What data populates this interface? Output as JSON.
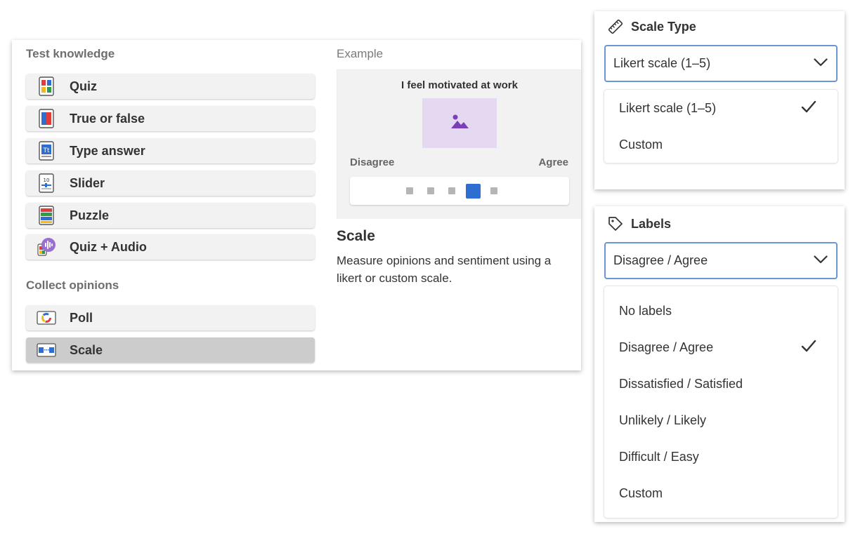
{
  "question_types": {
    "test_knowledge_title": "Test knowledge",
    "test_knowledge_items": [
      {
        "label": "Quiz",
        "icon": "quiz-icon"
      },
      {
        "label": "True or false",
        "icon": "true-false-icon"
      },
      {
        "label": "Type answer",
        "icon": "type-answer-icon"
      },
      {
        "label": "Slider",
        "icon": "slider-icon"
      },
      {
        "label": "Puzzle",
        "icon": "puzzle-icon"
      },
      {
        "label": "Quiz + Audio",
        "icon": "quiz-audio-icon"
      }
    ],
    "collect_opinions_title": "Collect opinions",
    "collect_opinions_items": [
      {
        "label": "Poll",
        "icon": "poll-icon"
      },
      {
        "label": "Scale",
        "icon": "scale-icon",
        "selected": true
      }
    ]
  },
  "example": {
    "label": "Example",
    "question": "I feel motivated at work",
    "left_label": "Disagree",
    "right_label": "Agree",
    "scale_points": 5,
    "selected_point": 4,
    "title": "Scale",
    "description": "Measure opinions and sentiment using a likert or custom scale."
  },
  "scale_type": {
    "title": "Scale Type",
    "icon": "ruler-icon",
    "selected": "Likert scale (1–5)",
    "options": [
      "Likert scale (1–5)",
      "Custom"
    ],
    "checked_index": 0
  },
  "labels": {
    "title": "Labels",
    "icon": "tag-icon",
    "selected": "Disagree / Agree",
    "options": [
      "No labels",
      "Disagree / Agree",
      "Dissatisfied / Satisfied",
      "Unlikely / Likely",
      "Difficult / Easy",
      "Custom"
    ],
    "checked_index": 1
  },
  "colors": {
    "accent": "#2d6ed0",
    "select_border": "#6b95d6",
    "image_placeholder": "#e4d9f0",
    "image_icon": "#7b3fb8",
    "selected_item_bg": "#cccccc"
  }
}
